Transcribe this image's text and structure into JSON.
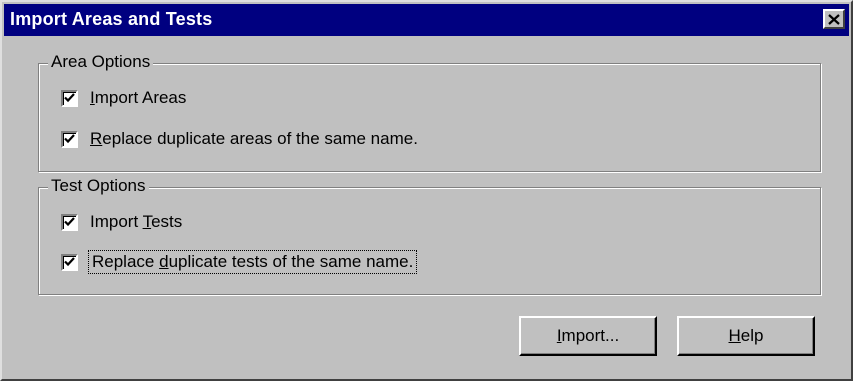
{
  "window": {
    "title": "Import Areas and Tests",
    "close_icon": "close-icon",
    "colors": {
      "titlebar": "#000080",
      "face": "#c0c0c0"
    }
  },
  "area_options": {
    "legend": "Area Options",
    "import_areas": {
      "label_pre": "",
      "label_key": "I",
      "label_post": "mport Areas",
      "checked": true
    },
    "replace_areas": {
      "label_pre": "",
      "label_key": "R",
      "label_post": "eplace duplicate areas of the same name.",
      "checked": true
    }
  },
  "test_options": {
    "legend": "Test Options",
    "import_tests": {
      "label_pre": "Import ",
      "label_key": "T",
      "label_post": "ests",
      "checked": true
    },
    "replace_tests": {
      "label_pre": "Replace ",
      "label_key": "d",
      "label_post": "uplicate tests of the same name.",
      "checked": true
    }
  },
  "buttons": {
    "import": {
      "pre": "",
      "key": "I",
      "post": "mport..."
    },
    "help": {
      "pre": "",
      "key": "H",
      "post": "elp"
    }
  }
}
